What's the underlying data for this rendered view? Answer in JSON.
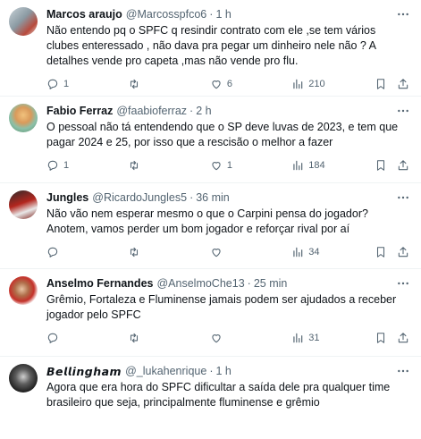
{
  "tweets": [
    {
      "name": "Marcos araujo",
      "handle": "@Marcosspfco6",
      "dot": "·",
      "time": "1 h",
      "text": "Não entendo pq o SPFC q resindir contrato com ele ,se tem vários clubes enteressado , não dava pra pegar um dinheiro nele não ? A detalhes vende pro capeta ,mas não vende pro flu.",
      "replies": "1",
      "retweets": "",
      "likes": "6",
      "views": "210"
    },
    {
      "name": "Fabio Ferraz",
      "handle": "@faabioferraz",
      "dot": "·",
      "time": "2 h",
      "text": "O pessoal não tá entendendo que o SP deve luvas de 2023, e tem que pagar 2024 e 25, por isso que a rescisão o melhor a fazer",
      "replies": "1",
      "retweets": "",
      "likes": "1",
      "views": "184"
    },
    {
      "name": "Jungles",
      "handle": "@RicardoJungles5",
      "dot": "·",
      "time": "36 min",
      "text": "Não vão nem esperar mesmo o que o Carpini pensa do jogador? Anotem, vamos perder um bom jogador e reforçar rival por aí",
      "replies": "",
      "retweets": "",
      "likes": "",
      "views": "34"
    },
    {
      "name": "Anselmo Fernandes",
      "handle": "@AnselmoChe13",
      "dot": "·",
      "time": "25 min",
      "text": "Grêmio, Fortaleza e Fluminense jamais podem ser ajudados a receber jogador pelo SPFC",
      "replies": "",
      "retweets": "",
      "likes": "",
      "views": "31"
    },
    {
      "name": "𝘽𝙚𝙡𝙡𝙞𝙣𝙜𝙝𝙖𝙢",
      "handle": "@_lukahenrique",
      "dot": "·",
      "time": "1 h",
      "text": "Agora que era hora do SPFC dificultar a saída dele pra qualquer time brasileiro que seja, principalmente fluminense e grêmio",
      "replies": "",
      "retweets": "",
      "likes": "",
      "views": ""
    }
  ]
}
